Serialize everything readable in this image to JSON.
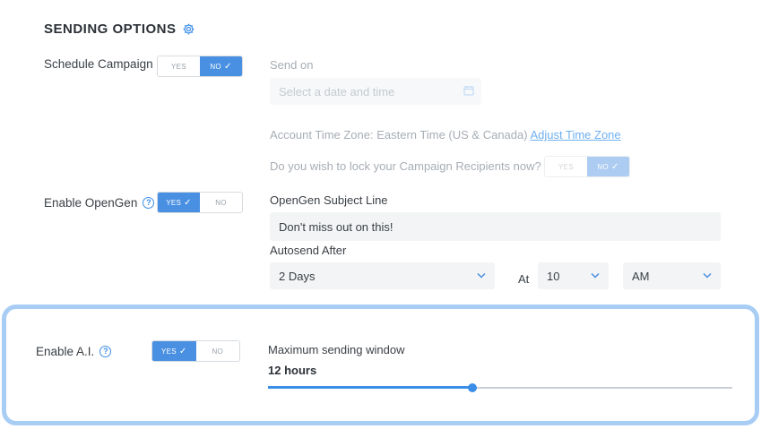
{
  "section": {
    "title": "SENDING OPTIONS"
  },
  "schedule": {
    "label": "Schedule Campaign",
    "yes": "YES",
    "no": "NO",
    "selected": "NO",
    "send_on_label": "Send on",
    "date_placeholder": "Select a date and time",
    "timezone_text": "Account Time Zone: Eastern Time (US & Canada)",
    "timezone_link": "Adjust Time Zone",
    "lock_question": "Do you wish to lock your Campaign Recipients now?",
    "lock_yes": "YES",
    "lock_no": "NO",
    "lock_selected": "NO"
  },
  "opengen": {
    "label": "Enable OpenGen",
    "help": "?",
    "yes": "YES",
    "no": "NO",
    "selected": "YES",
    "subject_label": "OpenGen Subject Line",
    "subject_value": "Don't miss out on this!",
    "autosend_label": "Autosend After",
    "autosend_value": "2 Days",
    "at_label": "At",
    "hour_value": "10",
    "ampm_value": "AM"
  },
  "ai": {
    "label": "Enable A.I.",
    "help": "?",
    "yes": "YES",
    "no": "NO",
    "selected": "YES",
    "window_label": "Maximum sending window",
    "window_value": "12 hours",
    "slider_fraction": 0.44
  },
  "colors": {
    "accent": "#4a90e2",
    "panel_border": "#a8cdf5",
    "link": "#6fb0f0"
  },
  "icons": [
    "gear-icon",
    "help-icon",
    "check-icon",
    "calendar-icon",
    "chevron-down-icon"
  ]
}
